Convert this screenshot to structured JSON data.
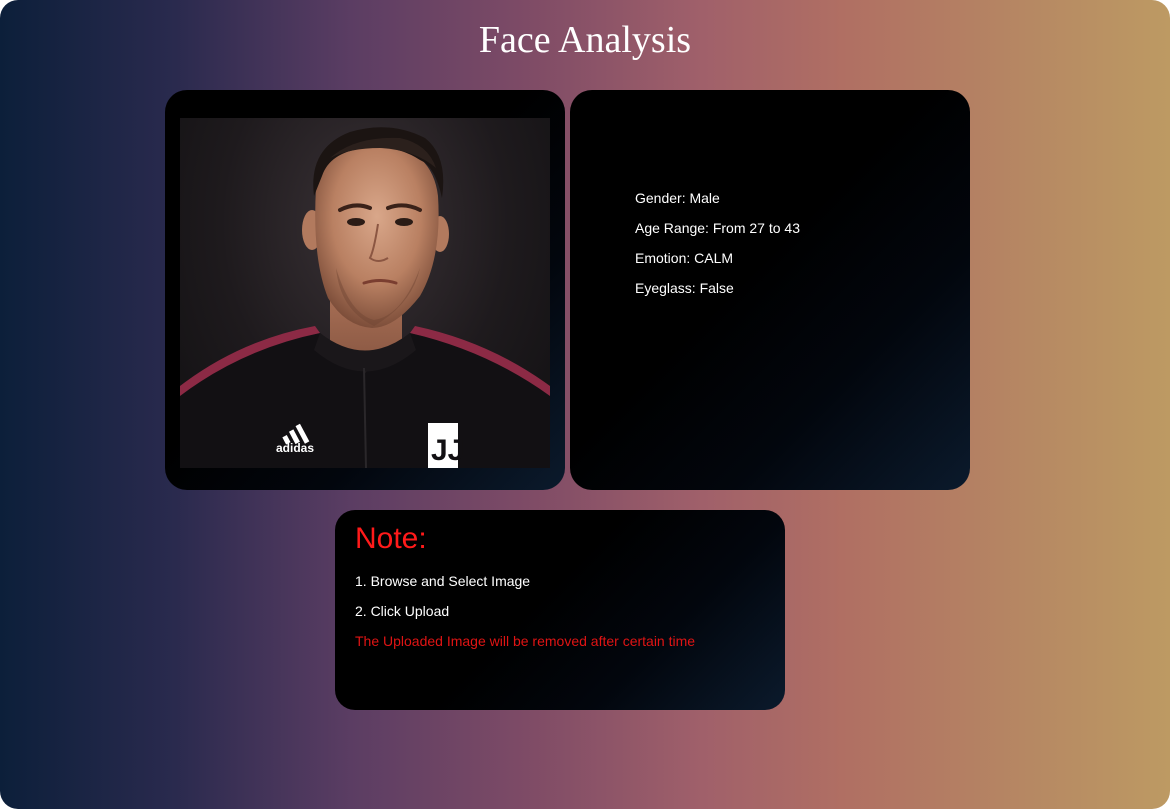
{
  "page": {
    "title": "Face Analysis"
  },
  "photo": {
    "alt": "Uploaded face photo",
    "jersey_brand": "adidas",
    "jersey_crest": "JJ"
  },
  "analysis": {
    "items": [
      {
        "label": "Gender: Male"
      },
      {
        "label": "Age Range: From 27 to 43"
      },
      {
        "label": "Emotion: CALM"
      },
      {
        "label": "Eyeglass: False"
      }
    ]
  },
  "note": {
    "title": "Note:",
    "steps": [
      {
        "label": "1. Browse and Select Image"
      },
      {
        "label": "2. Click Upload"
      }
    ],
    "warning": "The Uploaded Image will be removed after certain time"
  },
  "colors": {
    "note_title": "#ff1a1a",
    "warning": "#e01414",
    "card_background": "#000000"
  }
}
